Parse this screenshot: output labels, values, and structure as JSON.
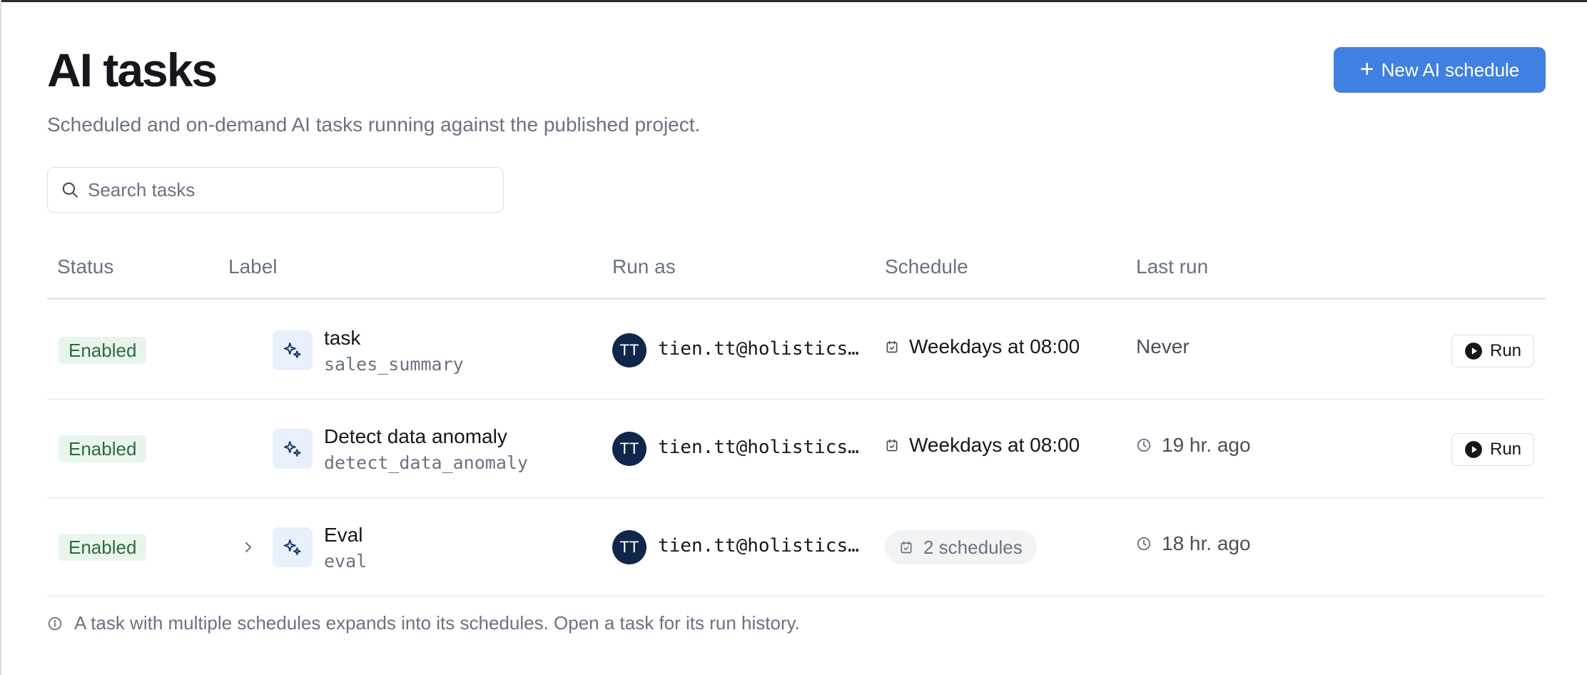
{
  "header": {
    "title": "AI tasks",
    "subtitle": "Scheduled and on-demand AI tasks running against the published project.",
    "new_button_label": "New AI schedule"
  },
  "search": {
    "placeholder": "Search tasks",
    "value": ""
  },
  "table": {
    "columns": {
      "status": "Status",
      "label": "Label",
      "run_as": "Run as",
      "schedule": "Schedule",
      "last_run": "Last run"
    },
    "rows": [
      {
        "status": "Enabled",
        "name": "task",
        "key": "sales_summary",
        "avatar_initials": "TT",
        "run_as": "tien.tt@holistics.io",
        "schedule": "Weekdays at 08:00",
        "last_run": "Never",
        "run_label": "Run"
      },
      {
        "status": "Enabled",
        "name": "Detect data anomaly",
        "key": "detect_data_anomaly",
        "avatar_initials": "TT",
        "run_as": "tien.tt@holistics.io",
        "schedule": "Weekdays at 08:00",
        "last_run": "19 hr. ago",
        "run_label": "Run"
      },
      {
        "status": "Enabled",
        "name": "Eval",
        "key": "eval",
        "avatar_initials": "TT",
        "run_as": "tien.tt@holistics.io",
        "schedule": "2 schedules",
        "last_run": "18 hr. ago"
      }
    ]
  },
  "footnote": "A task with multiple schedules expands into its schedules. Open a task for its run history.",
  "colors": {
    "accent": "#3f80e0",
    "badge_bg": "#e9f5ec",
    "badge_text": "#2f6a40",
    "avatar_bg": "#10264a"
  },
  "icons": [
    "plus-icon",
    "search-icon",
    "sparkle-icon",
    "calendar-icon",
    "clock-icon",
    "play-icon",
    "chevron-right-icon",
    "info-icon"
  ]
}
